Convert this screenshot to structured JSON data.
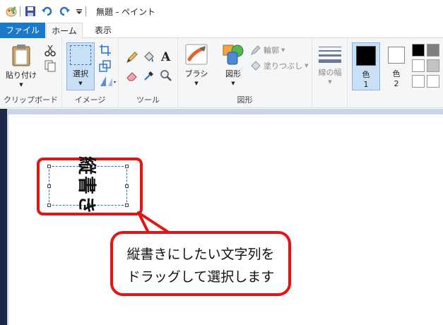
{
  "window": {
    "title": "無題 - ペイント"
  },
  "tabs": [
    {
      "label": "ファイル"
    },
    {
      "label": "ホーム"
    },
    {
      "label": "表示"
    }
  ],
  "ribbon": {
    "clipboard": {
      "paste_label": "貼り付け",
      "group_label": "クリップボード"
    },
    "image": {
      "select_label": "選択",
      "group_label": "イメージ"
    },
    "tools": {
      "group_label": "ツール"
    },
    "shapes": {
      "brush_label": "ブラシ",
      "shape_label": "図形",
      "outline_label": "輪郭",
      "fill_label": "塗りつぶし",
      "group_label": "図形"
    },
    "size": {
      "label": "線の幅"
    },
    "colors": {
      "color1_label": "色",
      "color1_num": "1",
      "color2_label": "色",
      "color2_num": "2",
      "color1_value": "#000000",
      "color2_value": "#ffffff",
      "palette": [
        "#000000",
        "#7f7f7f",
        "#ffffff",
        "#c3c3c3",
        "#ffffff",
        "#ffffff"
      ]
    }
  },
  "canvas": {
    "vertical_text": "縦書き"
  },
  "callout": {
    "line1": "縦書きにしたい文字列を",
    "line2": "ドラッグして選択します"
  },
  "colors": {
    "accent": "#1979ca",
    "highlight": "#e01515",
    "selection": "#2a6fcf"
  }
}
